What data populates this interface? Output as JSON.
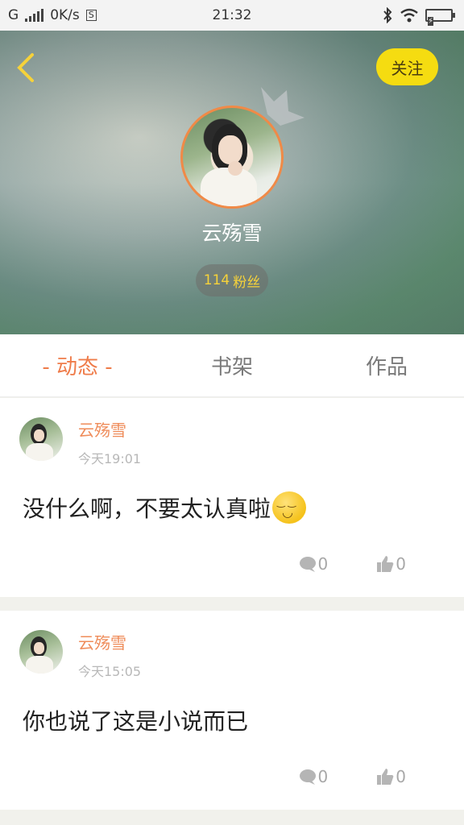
{
  "status_bar": {
    "carrier": "G",
    "net_speed": "0K/s",
    "sim": "S",
    "time": "21:32"
  },
  "header": {
    "follow_label": "关注",
    "username": "云殇雪",
    "fans_count": "114",
    "fans_label": "粉丝"
  },
  "tabs": [
    {
      "label": "- 动态 -",
      "active": true
    },
    {
      "label": "书架",
      "active": false
    },
    {
      "label": "作品",
      "active": false
    }
  ],
  "posts": [
    {
      "author": "云殇雪",
      "time": "今天19:01",
      "content": "没什么啊，不要太认真啦",
      "has_emoji": true,
      "comments": "0",
      "likes": "0"
    },
    {
      "author": "云殇雪",
      "time": "今天15:05",
      "content": "你也说了这是小说而已",
      "has_emoji": false,
      "comments": "0",
      "likes": "0"
    }
  ],
  "colors": {
    "accent_orange": "#ef7c4a",
    "follow_yellow": "#f5dc11",
    "header_green": "#5b8a6e"
  }
}
